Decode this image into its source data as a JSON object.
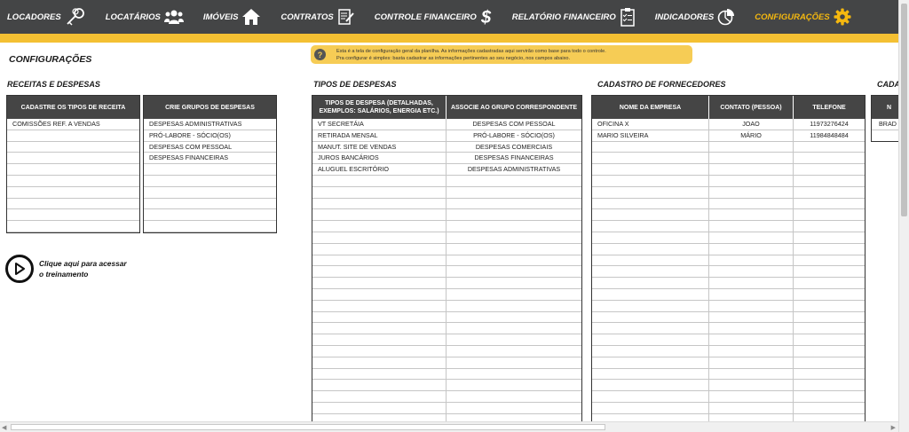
{
  "nav": {
    "items": [
      {
        "label": "LOCADORES",
        "icon": "keys-icon"
      },
      {
        "label": "LOCATÁRIOS",
        "icon": "users-icon"
      },
      {
        "label": "IMÓVEIS",
        "icon": "house-icon"
      },
      {
        "label": "CONTRATOS",
        "icon": "contract-edit-icon"
      },
      {
        "label": "CONTROLE FINANCEIRO",
        "icon": "dollar-icon"
      },
      {
        "label": "RELATÓRIO FINANCEIRO",
        "icon": "clipboard-checklist-icon"
      },
      {
        "label": "INDICADORES",
        "icon": "pie-chart-icon"
      },
      {
        "label": "CONFIGURAÇÕES",
        "icon": "gear-icon",
        "active": true
      }
    ]
  },
  "colors": {
    "nav_bg": "#444546",
    "accent": "#f4c033",
    "active": "#f5b80f",
    "table_header": "#454545"
  },
  "page_title": "CONFIGURAÇÕES",
  "info": {
    "icon": "question-icon",
    "line1": "Esta é a tela de configuração geral da planilha. As informações cadastradas aqui servirão como base para todo o controle.",
    "line2": "Pra configurar é simples: basta cadastrar as informações pertinentes ao seu negócio, nos campos abaixo."
  },
  "sections": {
    "receitas": "RECEITAS E DESPESAS",
    "tipos": "TIPOS DE DESPESAS",
    "fornecedores": "CADASTRO DE FORNECEDORES",
    "cut": "CADA"
  },
  "tables": {
    "receita": {
      "header": "CADASTRE OS TIPOS DE RECEITA",
      "rows": [
        "COMISSÕES REF. A VENDAS",
        "",
        "",
        "",
        "",
        "",
        "",
        "",
        "",
        ""
      ]
    },
    "grupos": {
      "header": "CRIE GRUPOS DE DESPESAS",
      "rows": [
        "DESPESAS ADMINISTRATIVAS",
        "PRÓ-LABORE - SÓCIO(OS)",
        "DESPESAS COM PESSOAL",
        "DESPESAS FINANCEIRAS",
        "",
        "",
        "",
        "",
        "",
        ""
      ]
    },
    "tipos": {
      "headers": [
        "TIPOS DE DESPESA (DETALHADAS, EXEMPLOS: SALÁRIOS, ENERGIA ETC.)",
        "ASSOCIE AO GRUPO CORRESPONDENTE"
      ],
      "rows": [
        [
          "VT SECRETÁIA",
          "DESPESAS COM PESSOAL"
        ],
        [
          "RETIRADA MENSAL",
          "PRÓ-LABORE - SÓCIO(OS)"
        ],
        [
          "MANUT. SITE DE VENDAS",
          "DESPESAS COMERCIAIS"
        ],
        [
          "JUROS BANCÁRIOS",
          "DESPESAS FINANCEIRAS"
        ],
        [
          "ALUGUEL ESCRITÓRIO",
          "DESPESAS ADMINISTRATIVAS"
        ]
      ]
    },
    "fornecedores": {
      "headers": [
        "NOME DA EMPRESA",
        "CONTATO (PESSOA)",
        "TELEFONE"
      ],
      "rows": [
        [
          "OFICINA X",
          "JOAO",
          "11973276424"
        ],
        [
          "MARIO SILVEIRA",
          "MÁRIO",
          "11984848484"
        ]
      ]
    },
    "cut": {
      "header": "N",
      "rows": [
        "BRAD"
      ]
    }
  },
  "training": {
    "line1": "Clique aqui para acessar",
    "line2": "o treinamento"
  }
}
